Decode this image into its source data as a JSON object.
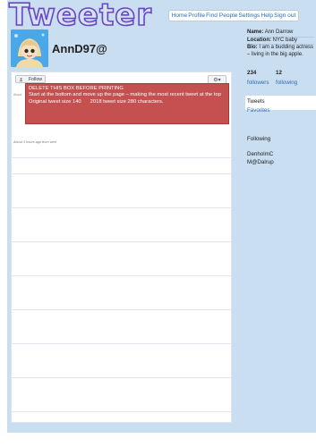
{
  "app": {
    "logo": "Tweeter"
  },
  "nav": {
    "items": [
      "Home",
      "Profile",
      "Find People",
      "Settings",
      "Help",
      "Sign out"
    ]
  },
  "profile": {
    "username": "AnnD97@"
  },
  "toolbar": {
    "follow_label": "Follow",
    "gear_label": "⚙▾"
  },
  "feed": {
    "about_top": "About",
    "notice": {
      "line1": "DELETE THIS BOX BEFORE PRINTING",
      "line2": "Start at the bottom and move up the page – making the most recent tweet at the top",
      "line3a": "Original tweet size 140",
      "line3b": "2018 tweet size 280 characters."
    },
    "timestamp": "About 3 hours ago from web"
  },
  "sidebar": {
    "name_label": "Name:",
    "name_value": "Ann Darrow",
    "location_label": "Location:",
    "location_value": "NYC baby",
    "bio_label": "Bio:",
    "bio_value": "I am a budding actress – living in the big apple.",
    "followers_count": "234",
    "following_count": "12",
    "followers_label": "followers",
    "following_label": "following",
    "tab_tweets": "Tweets",
    "tab_favorites": "Favorites",
    "following_heading": "Following",
    "following_list": [
      "DenholmC",
      "M@Dalrup"
    ]
  },
  "colors": {
    "frame": "#c9def0",
    "logo_outline": "#6a45c4",
    "link": "#2a6db6",
    "notice_bg": "#c55050"
  }
}
